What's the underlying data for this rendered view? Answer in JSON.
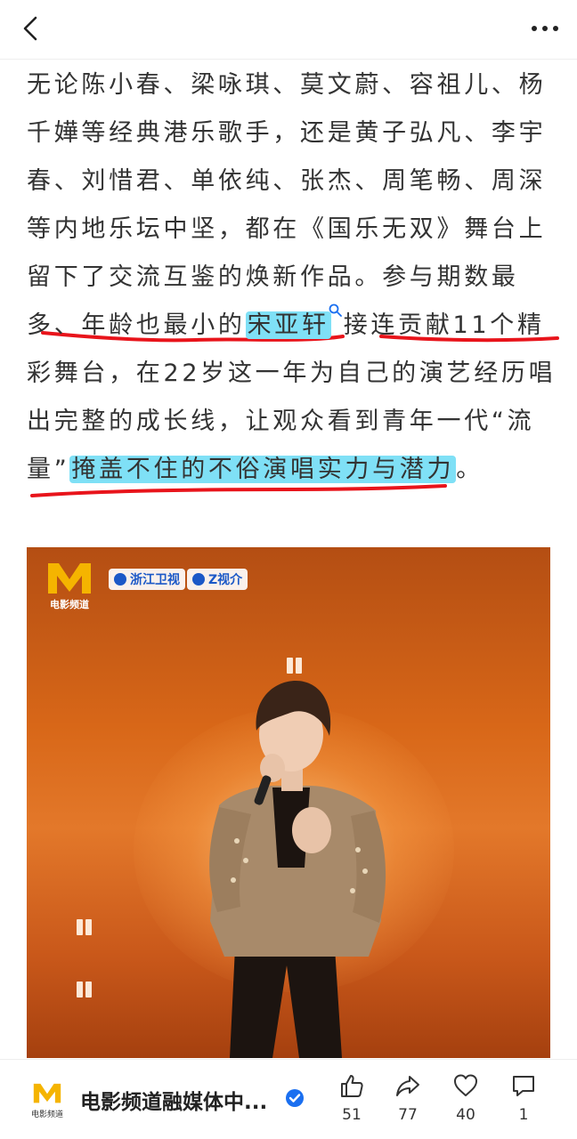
{
  "article": {
    "lines": [
      {
        "segments": [
          {
            "text": "无论陈小春、梁咏琪、莫文蔚、容祖儿、杨"
          }
        ]
      },
      {
        "segments": [
          {
            "text": "千嬅等经典港乐歌手，还是黄子弘凡、李宇"
          }
        ]
      },
      {
        "segments": [
          {
            "text": "春、刘惜君、单依纯、张杰、周笔畅、周深"
          }
        ]
      },
      {
        "segments": [
          {
            "text": "等内地乐坛中坚，都在《国乐无双》舞台上"
          }
        ]
      },
      {
        "segments": [
          {
            "text": "留下了交流互鉴的焕新作品。参与期数最"
          }
        ]
      },
      {
        "segments": [
          {
            "text": "多、年龄也最小的"
          },
          {
            "text": "宋亚轩",
            "highlight": true,
            "search": true
          },
          {
            "text": "接连贡献11个精"
          }
        ]
      },
      {
        "segments": [
          {
            "text": "彩舞台，在22岁这一年为自己的演艺经历唱"
          }
        ]
      },
      {
        "segments": [
          {
            "text": "出完整的成长线，让观众看到青年一代“流"
          }
        ]
      },
      {
        "segments": [
          {
            "text": "量”"
          },
          {
            "text": "掩盖不住的不俗演唱实力与潜力",
            "highlight": true
          },
          {
            "text": "。"
          }
        ]
      }
    ],
    "highlight_color": "#7fe0f6",
    "underline_color": "#e8141b"
  },
  "photo": {
    "logo_text": "电影频道",
    "badges": [
      "浙江卫视",
      "Z视介"
    ]
  },
  "footer": {
    "author_name": "电影频道融媒体中...",
    "author_logo_text": "电影频道",
    "actions": [
      {
        "icon": "thumbs-up-icon",
        "count": "51"
      },
      {
        "icon": "share-icon",
        "count": "77"
      },
      {
        "icon": "heart-icon",
        "count": "40"
      },
      {
        "icon": "comment-icon",
        "count": "1"
      }
    ]
  },
  "icons": {
    "back": "chevron-left-icon",
    "more": "more-dots-icon",
    "verified": "verified-badge-icon"
  },
  "colors": {
    "verified": "#1a6ff0",
    "logo_yellow": "#f5b400"
  }
}
